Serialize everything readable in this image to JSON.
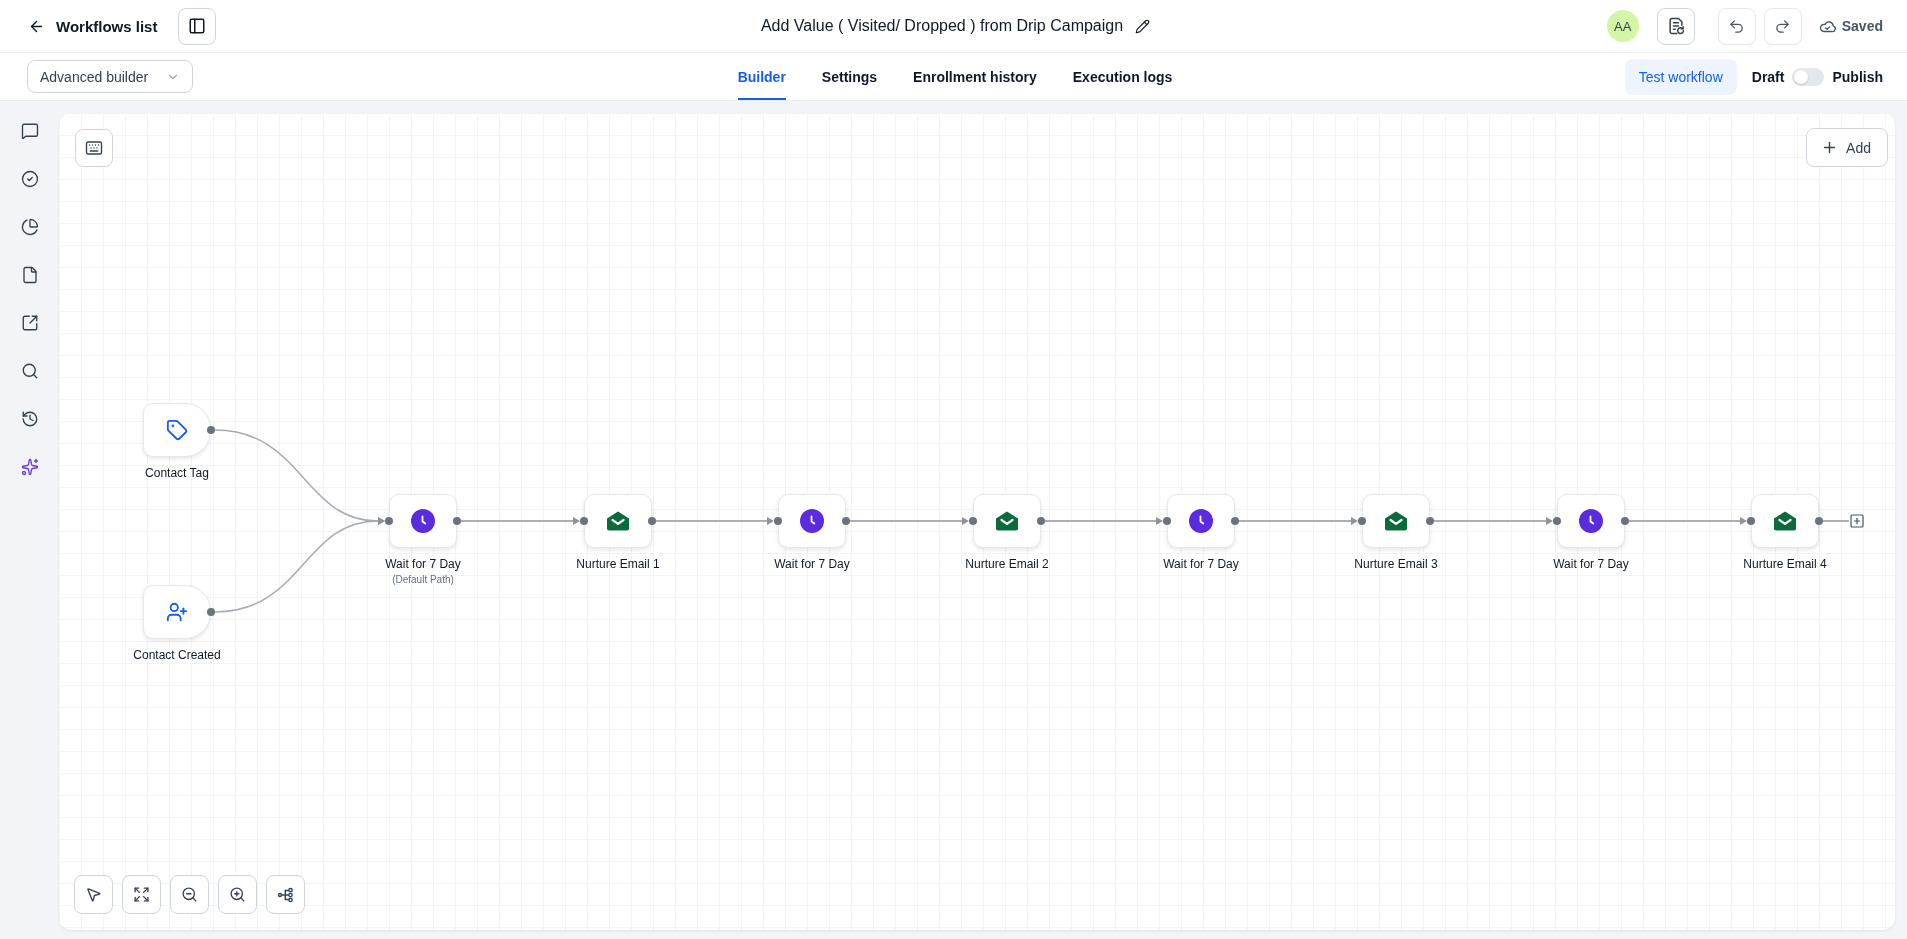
{
  "header": {
    "back_link": "Workflows list",
    "title": "Add Value ( Visited/ Dropped ) from Drip Campaign",
    "avatar": "AA",
    "save_status": "Saved"
  },
  "toolbar": {
    "builder_mode": "Advanced builder",
    "tabs": [
      {
        "label": "Builder",
        "selected": true
      },
      {
        "label": "Settings",
        "selected": false
      },
      {
        "label": "Enrollment history",
        "selected": false
      },
      {
        "label": "Execution logs",
        "selected": false
      }
    ],
    "test_button": "Test workflow",
    "publish_toggle": {
      "off_label": "Draft",
      "on_label": "Publish",
      "on": false
    }
  },
  "canvas": {
    "add_button": "Add",
    "triggers": [
      {
        "kind": "tag",
        "label": "Contact Tag"
      },
      {
        "kind": "contact_created",
        "label": "Contact Created"
      }
    ],
    "actions": [
      {
        "kind": "wait",
        "label": "Wait for 7 Day",
        "sublabel": "(Default Path)"
      },
      {
        "kind": "email",
        "label": "Nurture Email 1"
      },
      {
        "kind": "wait",
        "label": "Wait for 7 Day"
      },
      {
        "kind": "email",
        "label": "Nurture Email 2"
      },
      {
        "kind": "wait",
        "label": "Wait for 7 Day"
      },
      {
        "kind": "email",
        "label": "Nurture Email 3"
      },
      {
        "kind": "wait",
        "label": "Wait for 7 Day"
      },
      {
        "kind": "email",
        "label": "Nurture Email 4"
      }
    ]
  }
}
